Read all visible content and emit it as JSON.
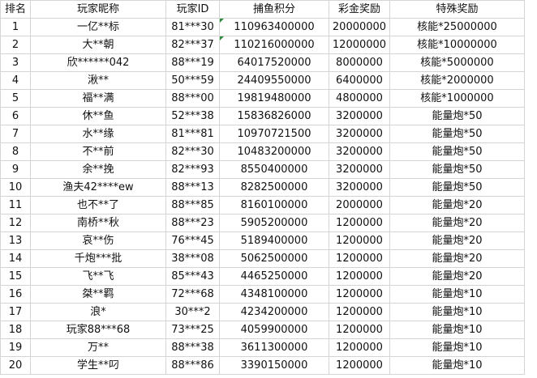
{
  "table": {
    "headers": [
      "排名",
      "玩家昵称",
      "玩家ID",
      "捕鱼积分",
      "彩金奖励",
      "特殊奖励"
    ],
    "rows": [
      [
        "1",
        "一亿**标",
        "81***30",
        "110963400000",
        "20000000",
        "核能*25000000"
      ],
      [
        "2",
        "大**朝",
        "82***37",
        "110216000000",
        "12000000",
        "核能*10000000"
      ],
      [
        "3",
        "欣******042",
        "88***19",
        "64017520000",
        "8000000",
        "核能*5000000"
      ],
      [
        "4",
        "湫**",
        "50***59",
        "24409550000",
        "6400000",
        "核能*2000000"
      ],
      [
        "5",
        "福**满",
        "88***00",
        "19819480000",
        "4800000",
        "核能*1000000"
      ],
      [
        "6",
        "休**鱼",
        "52***38",
        "15836826000",
        "3200000",
        "能量炮*50"
      ],
      [
        "7",
        "水**缘",
        "81***81",
        "10970721500",
        "3200000",
        "能量炮*50"
      ],
      [
        "8",
        "不**前",
        "82***30",
        "10483200000",
        "3200000",
        "能量炮*50"
      ],
      [
        "9",
        "余**挽",
        "82***93",
        "8550400000",
        "3200000",
        "能量炮*50"
      ],
      [
        "10",
        "渔夫42****ew",
        "88***13",
        "8282500000",
        "3200000",
        "能量炮*50"
      ],
      [
        "11",
        "也不**了",
        "88***85",
        "8160100000",
        "2000000",
        "能量炮*20"
      ],
      [
        "12",
        "南桥**秋",
        "88***23",
        "5905200000",
        "1200000",
        "能量炮*20"
      ],
      [
        "13",
        "哀**伤",
        "76***45",
        "5189400000",
        "1200000",
        "能量炮*20"
      ],
      [
        "14",
        "千炮***批",
        "38***08",
        "5062500000",
        "1200000",
        "能量炮*20"
      ],
      [
        "15",
        "飞**飞",
        "85***43",
        "4465250000",
        "1200000",
        "能量炮*20"
      ],
      [
        "16",
        "桀**羁",
        "72***68",
        "4348100000",
        "1200000",
        "能量炮*10"
      ],
      [
        "17",
        "浪*",
        "30***2",
        "4234200000",
        "1200000",
        "能量炮*10"
      ],
      [
        "18",
        "玩家88***68",
        "73***25",
        "4059900000",
        "1200000",
        "能量炮*10"
      ],
      [
        "19",
        "万**",
        "88***38",
        "3611300000",
        "1200000",
        "能量炮*10"
      ],
      [
        "20",
        "学生**叼",
        "88***86",
        "3390150000",
        "1200000",
        "能量炮*10"
      ]
    ],
    "marker_color": "#2e8b3a"
  }
}
